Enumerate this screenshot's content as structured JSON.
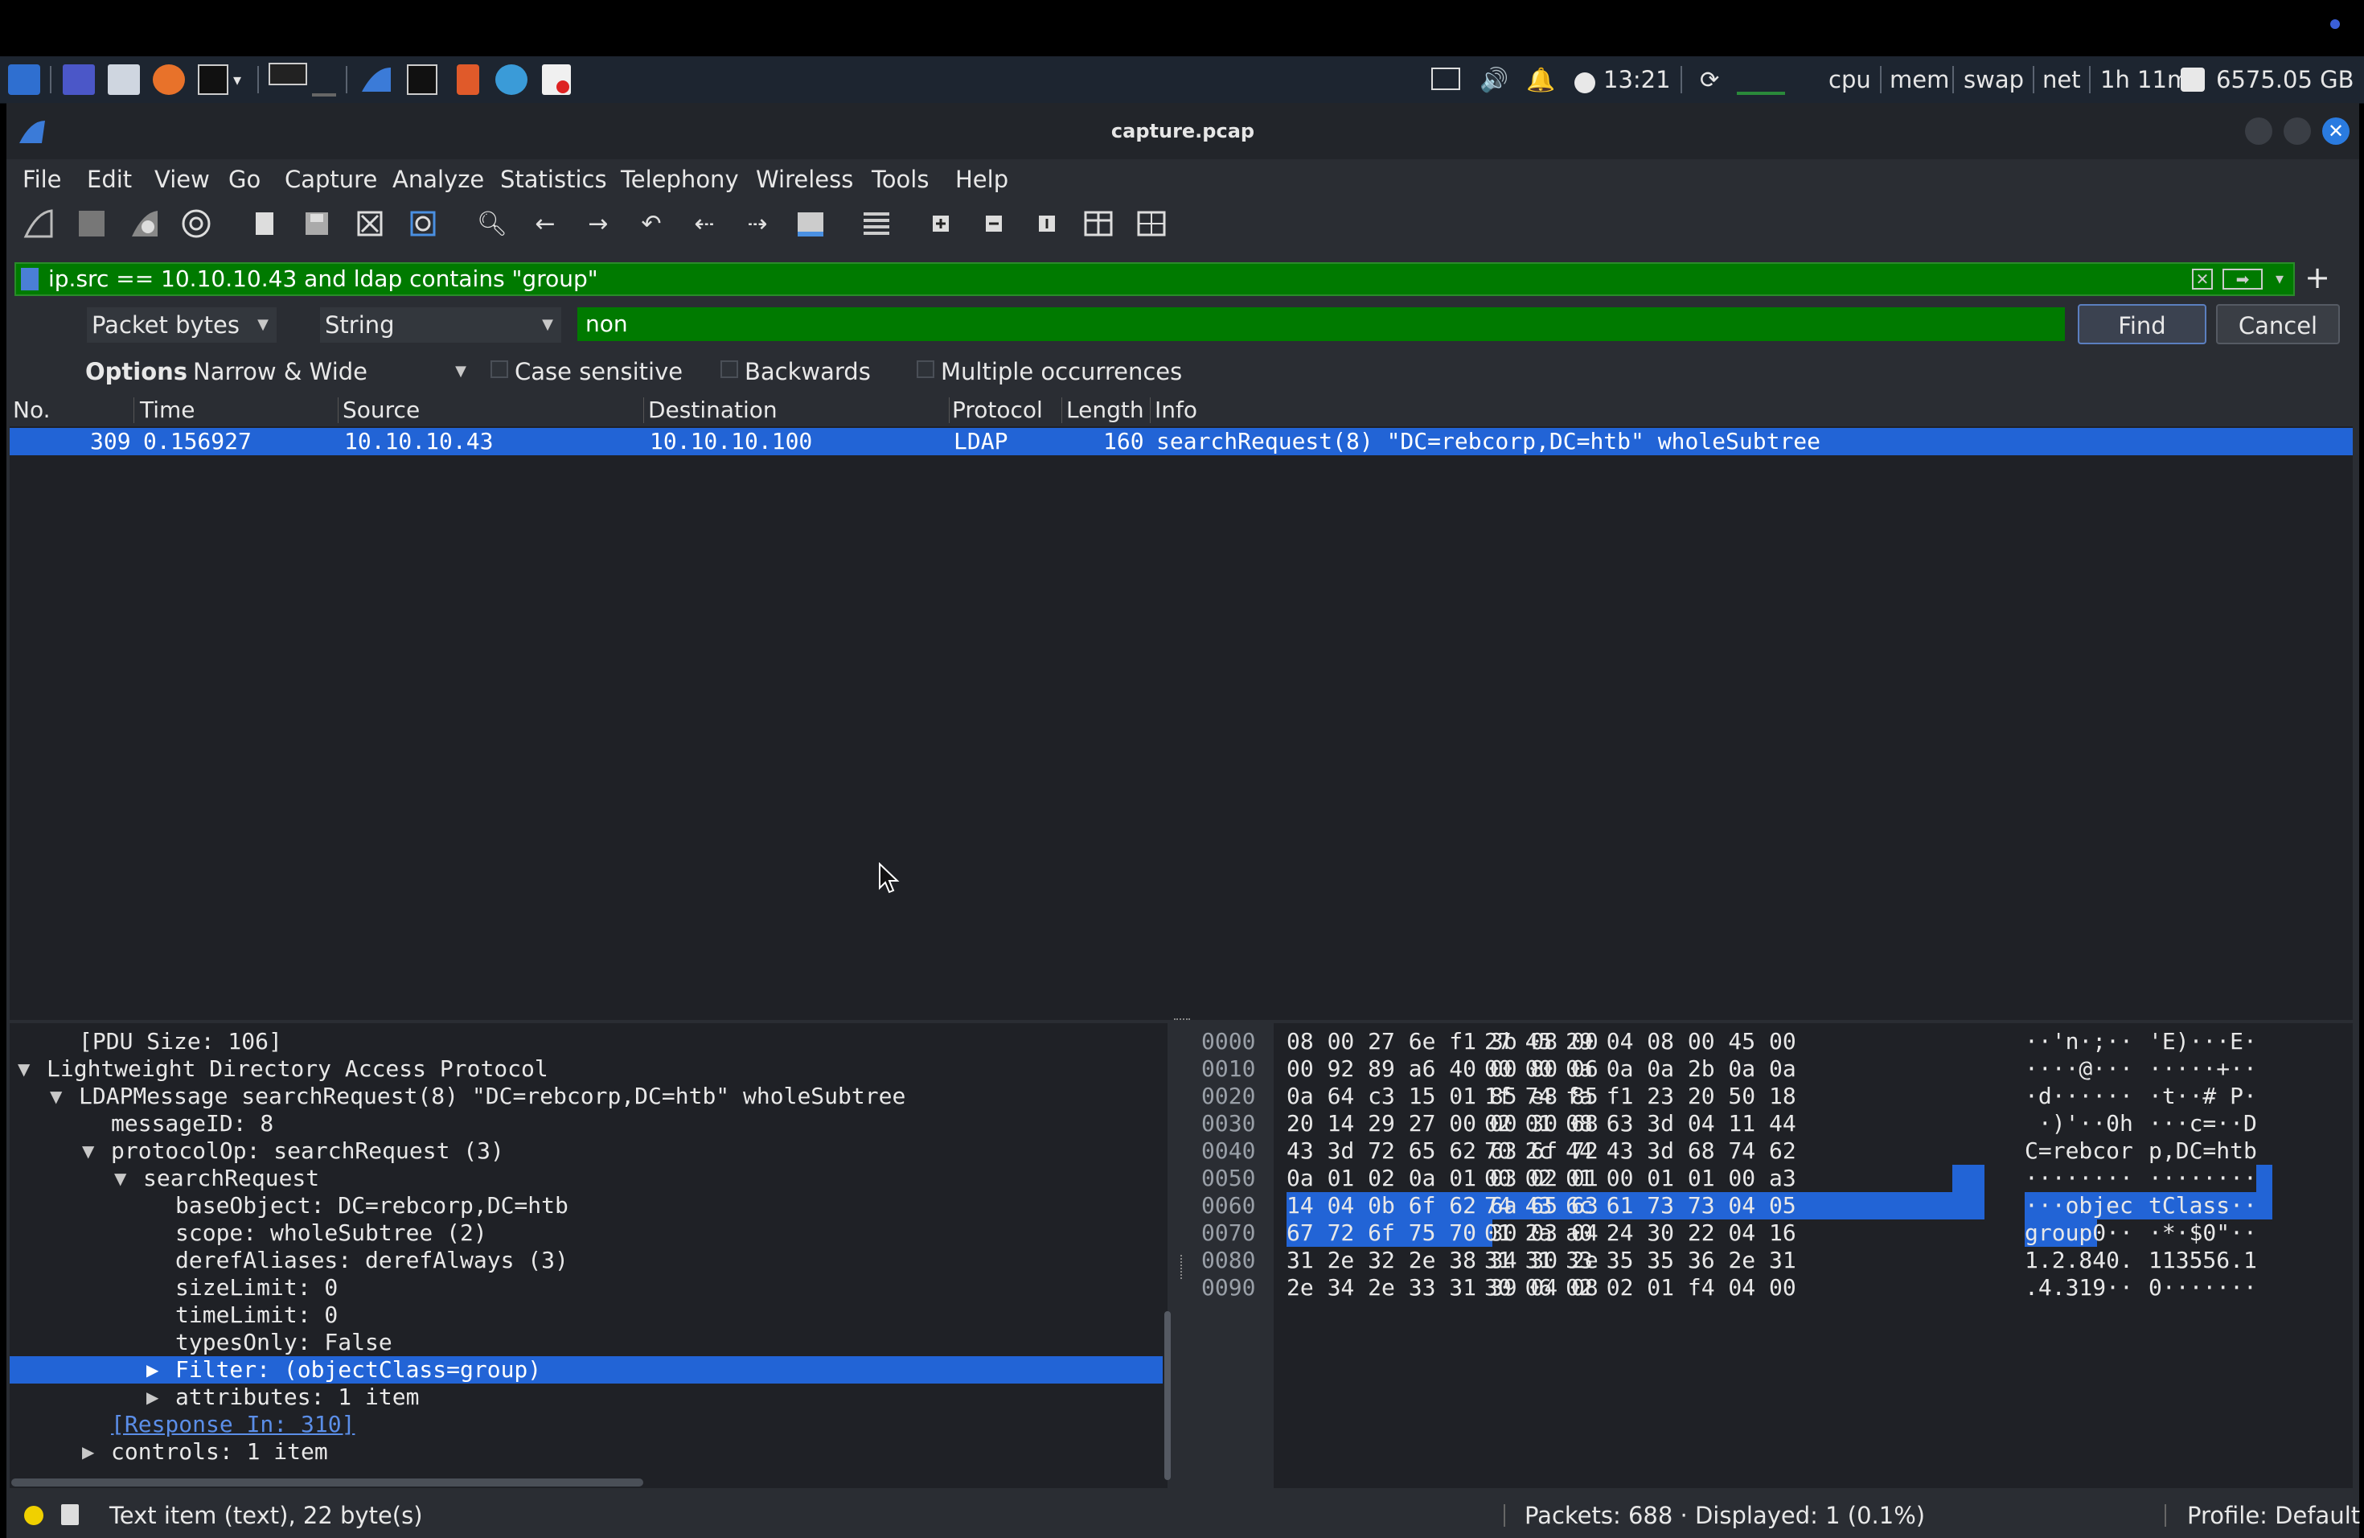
{
  "taskbar": {
    "time": "13:21",
    "cpu": "cpu",
    "mem": "mem",
    "swap": "swap",
    "net": "net",
    "uptime": "1h 11m",
    "disk": "6575.05 GB"
  },
  "window": {
    "title": "capture.pcap"
  },
  "menu": {
    "items": [
      "File",
      "Edit",
      "View",
      "Go",
      "Capture",
      "Analyze",
      "Statistics",
      "Telephony",
      "Wireless",
      "Tools",
      "Help"
    ]
  },
  "filter": {
    "expression": "ip.src == 10.10.10.43 and ldap contains \"group\""
  },
  "find": {
    "search_in": "Packet bytes",
    "type": "String",
    "value": "non",
    "find_label": "Find",
    "cancel_label": "Cancel",
    "options_label": "Options:",
    "char_width": "Narrow & Wide",
    "case_sensitive": "Case sensitive",
    "backwards": "Backwards",
    "multiple": "Multiple occurrences"
  },
  "packet_list": {
    "columns": [
      "No.",
      "Time",
      "Source",
      "Destination",
      "Protocol",
      "Length",
      "Info"
    ],
    "rows": [
      {
        "no": "309",
        "time": "0.156927",
        "source": "10.10.10.43",
        "destination": "10.10.10.100",
        "protocol": "LDAP",
        "length": "160",
        "info": "searchRequest(8) \"DC=rebcorp,DC=htb\" wholeSubtree"
      }
    ]
  },
  "details": {
    "lines": [
      "[PDU Size: 106]",
      "Lightweight Directory Access Protocol",
      "LDAPMessage searchRequest(8) \"DC=rebcorp,DC=htb\" wholeSubtree",
      "messageID: 8",
      "protocolOp: searchRequest (3)",
      "searchRequest",
      "baseObject: DC=rebcorp,DC=htb",
      "scope: wholeSubtree (2)",
      "derefAliases: derefAlways (3)",
      "sizeLimit: 0",
      "timeLimit: 0",
      "typesOnly: False",
      "Filter: (objectClass=group)",
      "attributes: 1 item",
      "[Response In: 310]",
      "controls: 1 item"
    ]
  },
  "bytes": {
    "rows": [
      {
        "off": "0000",
        "hex1": "08 00 27 6e f1 3b 08 00",
        "hex2": "27 45 29 04 08 00 45 00",
        "asc1": "··'n·;··",
        "asc2": "'E)···E·"
      },
      {
        "off": "0010",
        "hex1": "00 92 89 a6 40 00 80 06",
        "hex2": "00 00 0a 0a 0a 2b 0a 0a",
        "asc1": "····@···",
        "asc2": "·····+··"
      },
      {
        "off": "0020",
        "hex1": "0a 64 c3 15 01 85 e8 85",
        "hex2": "1f 74 fa f1 23 20 50 18",
        "asc1": "·d······",
        "asc2": "·t··# P·"
      },
      {
        "off": "0030",
        "hex1": "20 14 29 27 00 00 30 68",
        "hex2": "02 01 08 63 3d 04 11 44",
        "asc1": " ·)'··0h",
        "asc2": "···c=··D"
      },
      {
        "off": "0040",
        "hex1": "43 3d 72 65 62 63 6f 72",
        "hex2": "70 2c 44 43 3d 68 74 62",
        "asc1": "C=rebcor",
        "asc2": "p,DC=htb"
      },
      {
        "off": "0050",
        "hex1": "0a 01 02 0a 01 03 02 01",
        "hex2": "00 02 01 00 01 01 00 a3",
        "asc1": "········",
        "asc2": "········"
      },
      {
        "off": "0060",
        "hex1": "14 04 0b 6f 62 6a 65 63",
        "hex2": "74 43 6c 61 73 73 04 05",
        "asc1": "···objec",
        "asc2": "tClass··"
      },
      {
        "off": "0070",
        "hex1": "67 72 6f 75 70 30 03 04",
        "hex2": "01 2a a0 24 30 22 04 16",
        "asc1": "group0··",
        "asc2": "·*·$0\"··"
      },
      {
        "off": "0080",
        "hex1": "31 2e 32 2e 38 34 30 2e",
        "hex2": "31 31 33 35 35 36 2e 31",
        "asc1": "1.2.840.",
        "asc2": "113556.1"
      },
      {
        "off": "0090",
        "hex1": "2e 34 2e 33 31 39 04 08",
        "hex2": "30 06 02 02 01 f4 04 00",
        "asc1": ".4.319··",
        "asc2": "0·······"
      }
    ]
  },
  "status": {
    "item": "Text item (text), 22 byte(s)",
    "packets": "Packets: 688 · Displayed: 1 (0.1%)",
    "profile": "Profile: Default"
  },
  "colors": {
    "filter_ok": "#007a00",
    "selection": "#2264d6"
  }
}
